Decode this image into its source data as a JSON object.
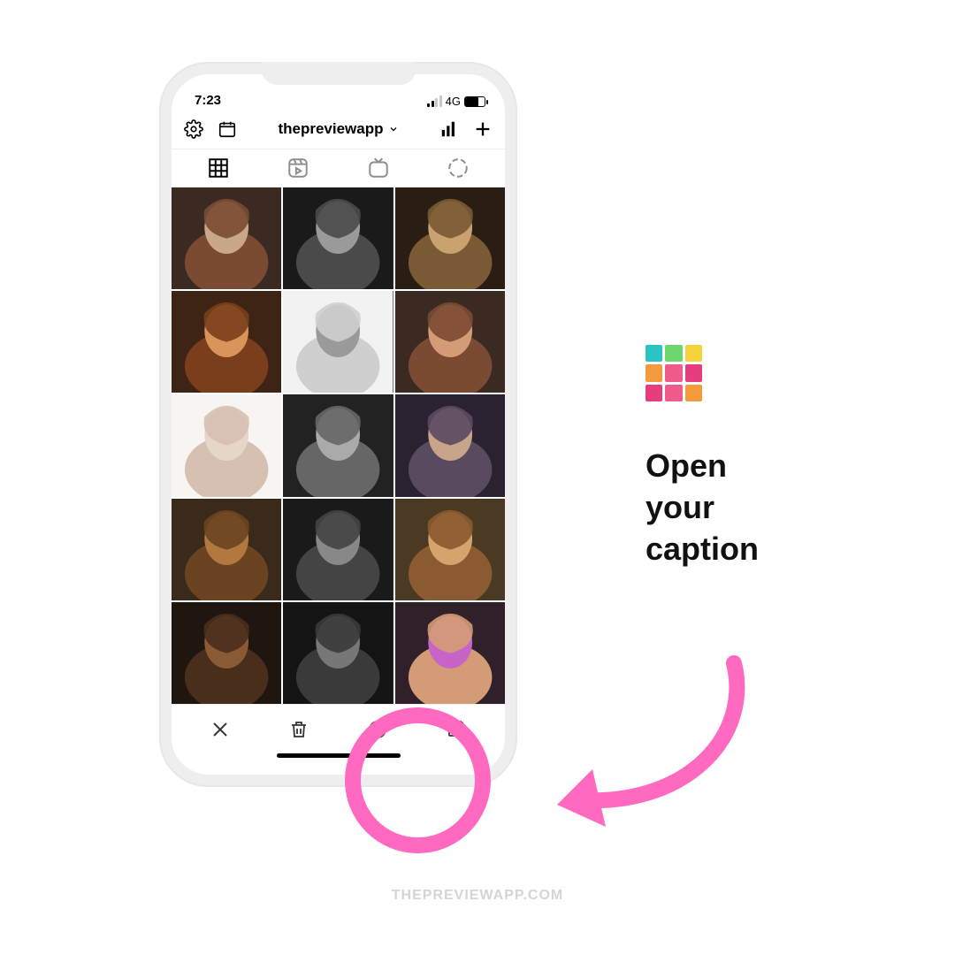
{
  "statusbar": {
    "time": "7:23",
    "network": "4G"
  },
  "toolbar": {
    "account": "thepreviewapp"
  },
  "logo_colors": [
    "#2bc4c4",
    "#6fd66f",
    "#f4d23c",
    "#f39a3c",
    "#ef5c8b",
    "#e73c7e",
    "#e73c7e",
    "#ef5c8b",
    "#f39a3c"
  ],
  "headline": {
    "l1": "Open",
    "l2": "your",
    "l3": "caption"
  },
  "watermark": "THEPREVIEWAPP.COM",
  "tile_palettes": [
    [
      "#3a2a22",
      "#c8a886",
      "#7a4a33"
    ],
    [
      "#1a1a1a",
      "#9a9a9a",
      "#4a4a4a"
    ],
    [
      "#2a1e14",
      "#caa270",
      "#7a5a34"
    ],
    [
      "#3d2414",
      "#d9945a",
      "#7a3e1c"
    ],
    [
      "#f2f2f2",
      "#9a9a9a",
      "#cfcfcf"
    ],
    [
      "#3a2a22",
      "#d49c76",
      "#7a4a33"
    ],
    [
      "#efe6df",
      "#c8a48b",
      "#a27456"
    ],
    [
      "#222",
      "#aaa",
      "#666"
    ],
    [
      "#2a2230",
      "#c8a48b",
      "#5a4a60"
    ],
    [
      "#3a2a1a",
      "#b27840",
      "#6a4420"
    ],
    [
      "#1a1a1a",
      "#888",
      "#444"
    ],
    [
      "#4a3a24",
      "#d4a46c",
      "#8a5a30"
    ],
    [
      "#201610",
      "#8a5a34",
      "#4a2e1c"
    ],
    [
      "#141414",
      "#777",
      "#3a3a3a"
    ],
    [
      "#30202a",
      "#c864c8",
      "#d49c76"
    ]
  ]
}
